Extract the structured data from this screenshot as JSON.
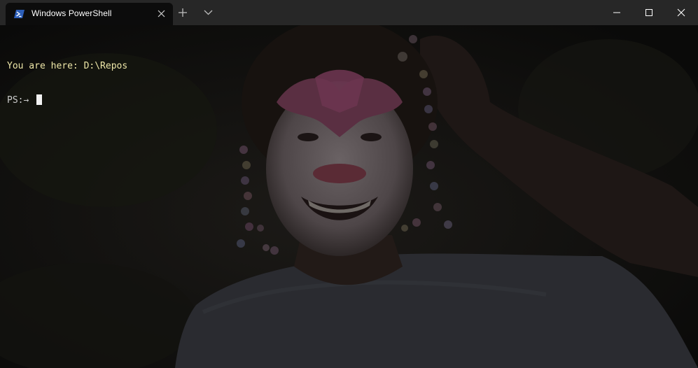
{
  "tab": {
    "title": "Windows PowerShell",
    "icon": "powershell-icon"
  },
  "toolbar": {
    "new_tab_icon": "plus-icon",
    "dropdown_icon": "chevron-down-icon"
  },
  "window_controls": {
    "minimize_icon": "minimize-icon",
    "maximize_icon": "maximize-icon",
    "close_icon": "close-icon"
  },
  "terminal": {
    "location_line": "You are here: D:\\Repos",
    "prompt": "PS:→ ",
    "background_image": "girl-with-face-paint-and-beaded-braids"
  },
  "colors": {
    "titlebar": "#272727",
    "terminal_bg": "#0c0c0c",
    "location_text": "#eee7a8",
    "prompt_text": "#cccccc",
    "powershell_blue": "#2c5eb8"
  }
}
